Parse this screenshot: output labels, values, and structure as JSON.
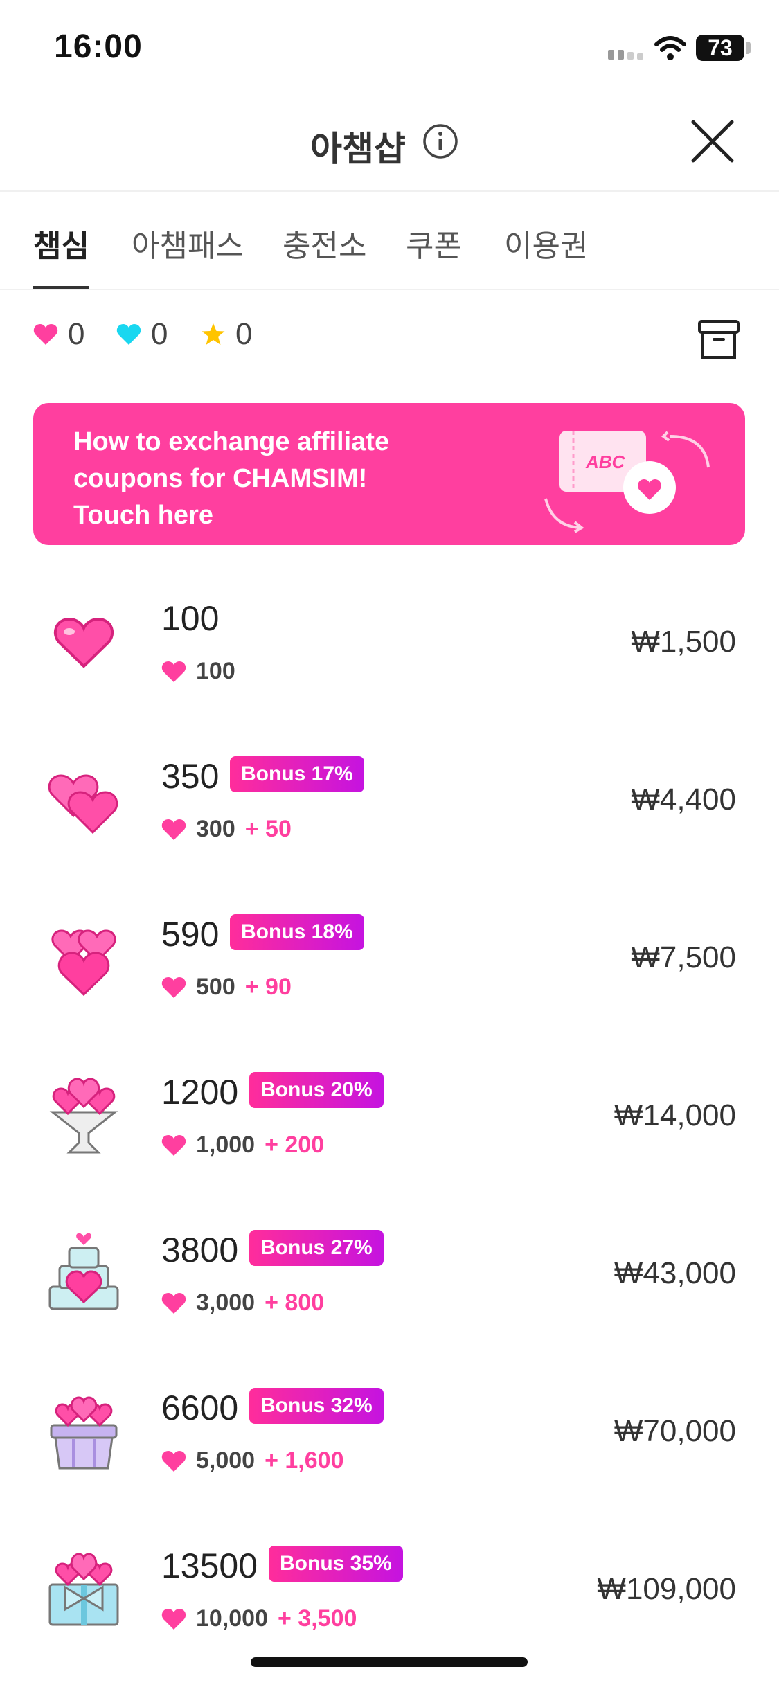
{
  "status_bar": {
    "time": "16:00",
    "battery": "73"
  },
  "header": {
    "title": "아챔샵"
  },
  "tabs": [
    {
      "label": "챔심",
      "active": true
    },
    {
      "label": "아챔패스",
      "active": false
    },
    {
      "label": "충전소",
      "active": false
    },
    {
      "label": "쿠폰",
      "active": false
    },
    {
      "label": "이용권",
      "active": false
    }
  ],
  "balances": [
    {
      "icon": "pink-heart-icon",
      "color": "#ff3f9f",
      "value": "0"
    },
    {
      "icon": "cyan-heart-icon",
      "color": "#19d7f0",
      "value": "0"
    },
    {
      "icon": "star-icon",
      "color": "#ffc400",
      "value": "0"
    }
  ],
  "banner": {
    "lines": [
      "How to exchange affiliate",
      "coupons for CHAMSIM!",
      "Touch here"
    ],
    "art_text": "ABC"
  },
  "products": [
    {
      "amount": "100",
      "bonus_badge": "",
      "base": "100",
      "bonus": "",
      "price": "₩1,500",
      "icon": "single-heart-icon"
    },
    {
      "amount": "350",
      "bonus_badge": "Bonus 17%",
      "base": "300",
      "bonus": "+ 50",
      "price": "₩4,400",
      "icon": "two-hearts-icon"
    },
    {
      "amount": "590",
      "bonus_badge": "Bonus 18%",
      "base": "500",
      "bonus": "+ 90",
      "price": "₩7,500",
      "icon": "heart-bundle-icon"
    },
    {
      "amount": "1200",
      "bonus_badge": "Bonus 20%",
      "base": "1,000",
      "bonus": "+ 200",
      "price": "₩14,000",
      "icon": "heart-bouquet-icon"
    },
    {
      "amount": "3800",
      "bonus_badge": "Bonus 27%",
      "base": "3,000",
      "bonus": "+ 800",
      "price": "₩43,000",
      "icon": "heart-cake-icon"
    },
    {
      "amount": "6600",
      "bonus_badge": "Bonus 32%",
      "base": "5,000",
      "bonus": "+ 1,600",
      "price": "₩70,000",
      "icon": "heart-gift-box-icon"
    },
    {
      "amount": "13500",
      "bonus_badge": "Bonus 35%",
      "base": "10,000",
      "bonus": "+ 3,500",
      "price": "₩109,000",
      "icon": "heart-ribbon-box-icon"
    }
  ],
  "colors": {
    "accent": "#ff3f9f",
    "badge_gradient_end": "#c513e0"
  }
}
